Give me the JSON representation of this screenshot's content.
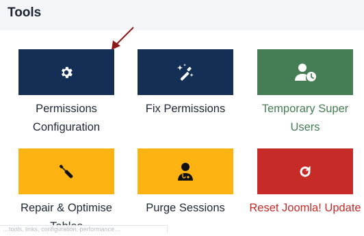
{
  "header": {
    "title": "Tools"
  },
  "tools": [
    {
      "label": "Permissions Configuration",
      "icon": "gear-icon",
      "color": "#132f55"
    },
    {
      "label": "Fix Permissions",
      "icon": "magic-wand-icon",
      "color": "#132f55"
    },
    {
      "label": "Temporary Super Users",
      "icon": "user-clock-icon",
      "color": "#457d54"
    },
    {
      "label": "Repair & Optimise Tables",
      "icon": "screwdriver-wrench-icon",
      "color": "#fdb413"
    },
    {
      "label": "Purge Sessions",
      "icon": "user-doctor-icon",
      "color": "#fdb413"
    },
    {
      "label": "Reset Joomla! Update",
      "icon": "refresh-icon",
      "color": "#c72b28"
    }
  ],
  "status_bar": {
    "text": "…tools, links, configuration, performance…"
  },
  "colors": {
    "navy": "#132f55",
    "green": "#457d54",
    "yellow": "#fdb413",
    "red": "#c72b28",
    "arrow": "#8b1a1a"
  }
}
